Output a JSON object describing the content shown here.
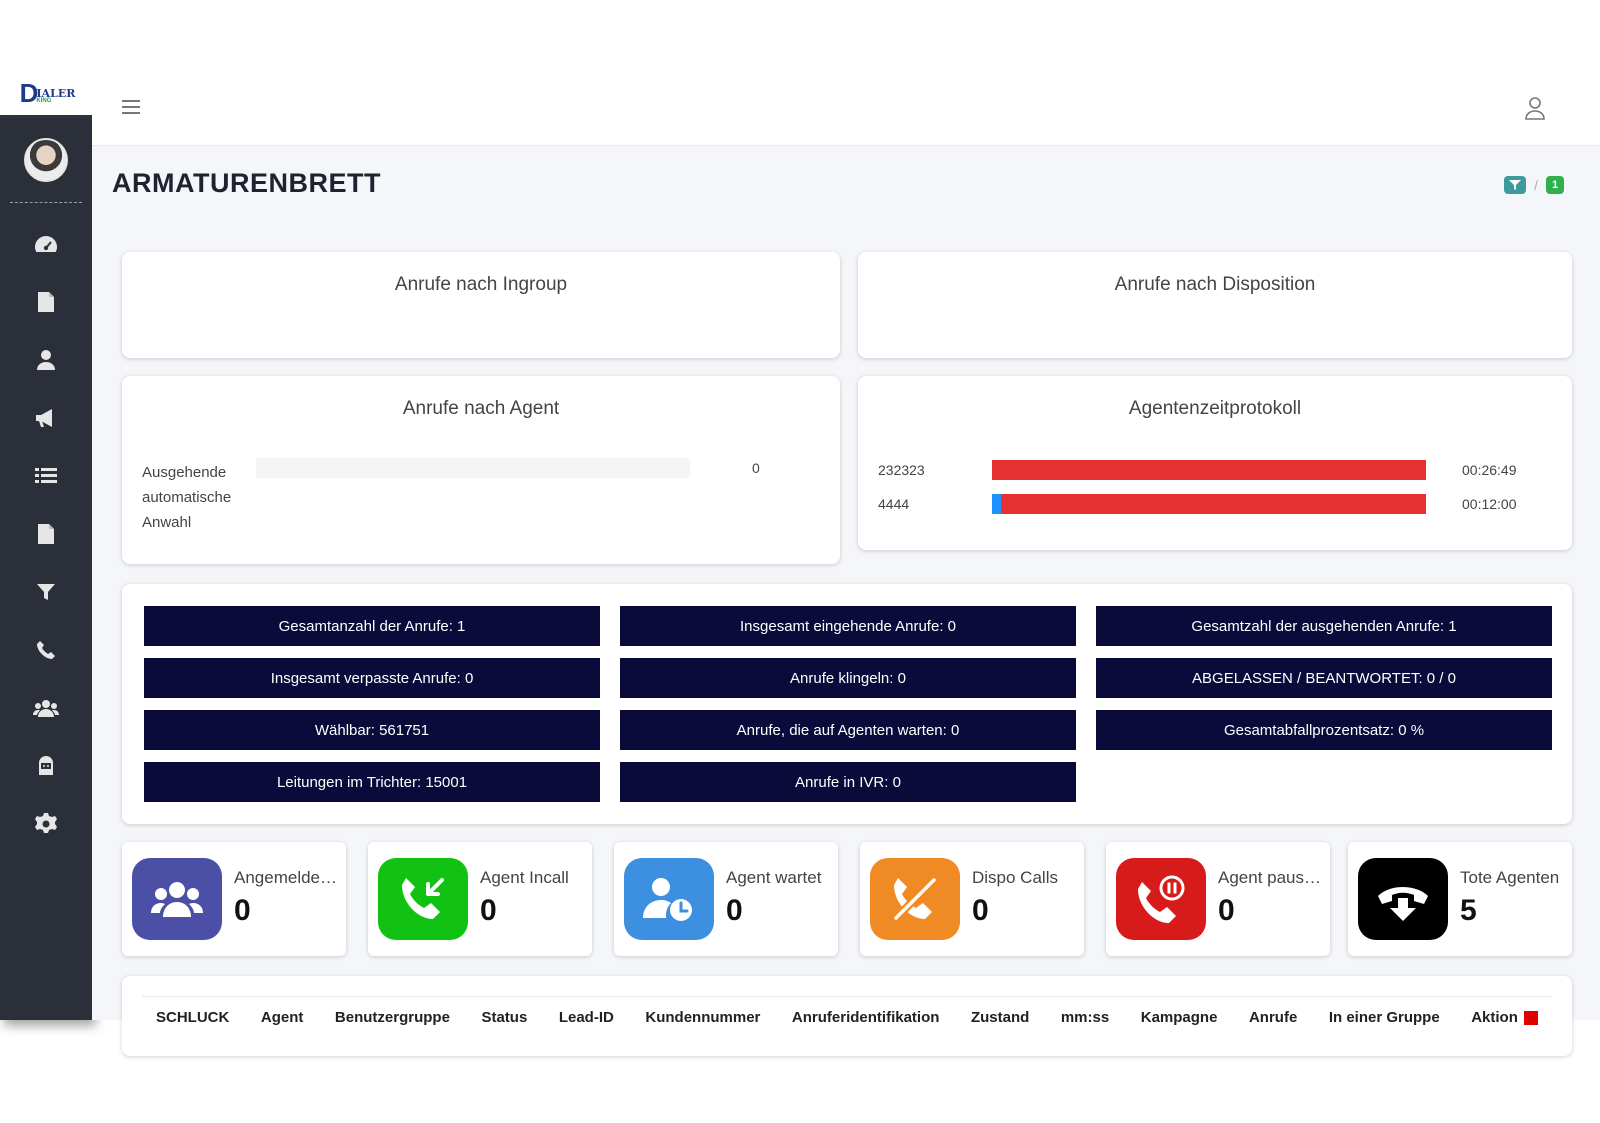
{
  "app": {
    "logo_text": "IALER",
    "logo_letter": "D",
    "logo_sub": "KING"
  },
  "page_title": "ARMATURENBRETT",
  "breadcrumb_separator": "/",
  "breadcrumb_badge": "1",
  "cards": {
    "ingroup_title": "Anrufe nach Ingroup",
    "disposition_title": "Anrufe nach Disposition",
    "agent_title": "Anrufe nach Agent",
    "agent_rows": [
      {
        "label": "Ausgehende automatische Anwahl",
        "value": "0"
      }
    ],
    "time_title": "Agentenzeitprotokoll",
    "time_rows": [
      {
        "name": "232323",
        "time": "00:26:49",
        "red_fraction": 1.0,
        "blue_fraction": 0.0
      },
      {
        "name": "4444",
        "time": "00:12:00",
        "red_fraction": 0.98,
        "blue_fraction": 0.02
      }
    ]
  },
  "stats": [
    "Gesamtanzahl der Anrufe: 1",
    "Insgesamt eingehende Anrufe: 0",
    "Gesamtzahl der ausgehenden Anrufe: 1",
    "Insgesamt verpasste Anrufe: 0",
    "Anrufe klingeln: 0",
    "ABGELASSEN / BEANTWORTET: 0 / 0",
    "Wählbar: 561751",
    "Anrufe, die auf Agenten warten: 0",
    "Gesamtabfallprozentsatz: 0 %",
    "Leitungen im Trichter: 15001",
    "Anrufe in IVR: 0"
  ],
  "kpis": [
    {
      "label": "Angemeldete Agenten",
      "value": "0",
      "icon": "users-icon",
      "color": "#4b4fa6"
    },
    {
      "label": "Agent Incall",
      "value": "0",
      "icon": "incoming-call-icon",
      "color": "#12c212"
    },
    {
      "label": "Agent wartet",
      "value": "0",
      "icon": "user-clock-icon",
      "color": "#3d8fe0"
    },
    {
      "label": "Dispo Calls",
      "value": "0",
      "icon": "phone-slash-icon",
      "color": "#f08a24"
    },
    {
      "label": "Agent pausiert",
      "value": "0",
      "icon": "phone-pause-icon",
      "color": "#d71b1b"
    },
    {
      "label": "Tote Agenten",
      "value": "5",
      "icon": "hangup-icon",
      "color": "#000000"
    }
  ],
  "table": {
    "columns": [
      "SCHLUCK",
      "Agent",
      "Benutzergruppe",
      "Status",
      "Lead-ID",
      "Kundennummer",
      "Anruferidentifikation",
      "Zustand",
      "mm:ss",
      "Kampagne",
      "Anrufe",
      "In einer Gruppe",
      "Aktion"
    ]
  },
  "colors": {
    "sidebar": "#2b2f3a",
    "stat_bg": "#0b0b3b",
    "bar_red": "#e53131",
    "bar_blue": "#1e90ff",
    "crumb_teal": "#3c9c9c",
    "crumb_green": "#2fb04a"
  }
}
